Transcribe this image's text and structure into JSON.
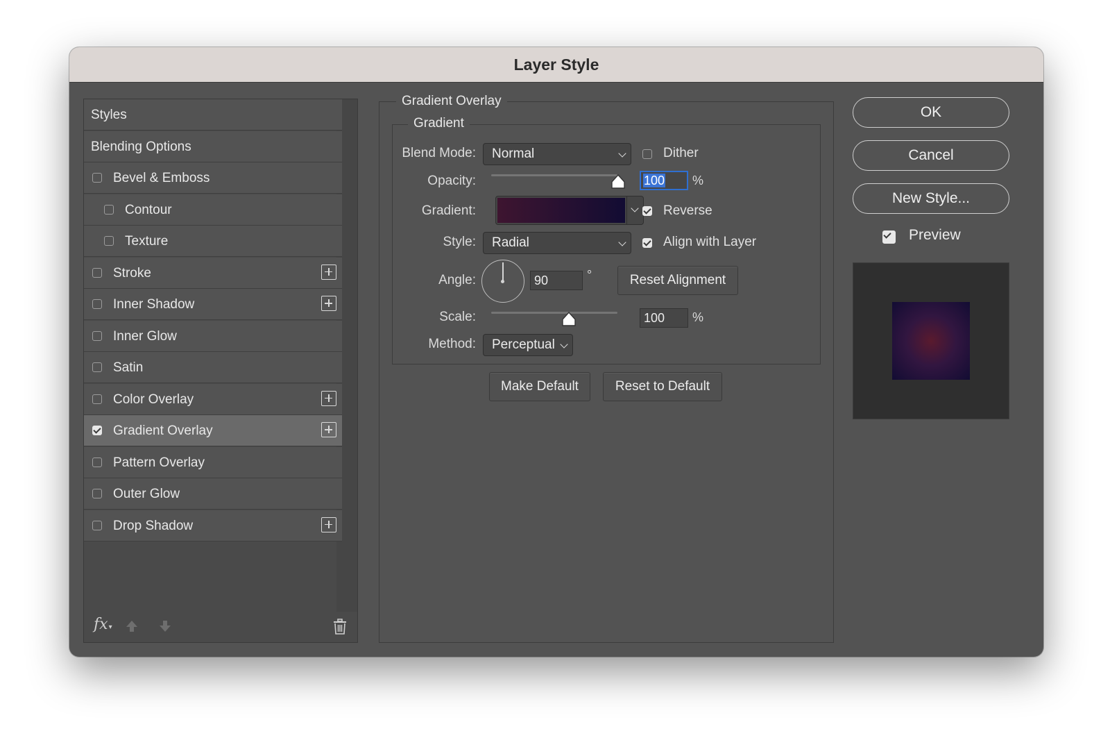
{
  "window": {
    "title": "Layer Style"
  },
  "styles_list": {
    "items": [
      {
        "label": "Styles",
        "type": "header"
      },
      {
        "label": "Blending Options",
        "type": "header"
      },
      {
        "label": "Bevel & Emboss",
        "type": "check",
        "checked": false,
        "plus": false
      },
      {
        "label": "Contour",
        "type": "sub",
        "checked": false,
        "plus": false
      },
      {
        "label": "Texture",
        "type": "sub",
        "checked": false,
        "plus": false
      },
      {
        "label": "Stroke",
        "type": "check",
        "checked": false,
        "plus": true
      },
      {
        "label": "Inner Shadow",
        "type": "check",
        "checked": false,
        "plus": true
      },
      {
        "label": "Inner Glow",
        "type": "check",
        "checked": false,
        "plus": false
      },
      {
        "label": "Satin",
        "type": "check",
        "checked": false,
        "plus": false
      },
      {
        "label": "Color Overlay",
        "type": "check",
        "checked": false,
        "plus": true
      },
      {
        "label": "Gradient Overlay",
        "type": "check",
        "checked": true,
        "plus": true,
        "selected": true
      },
      {
        "label": "Pattern Overlay",
        "type": "check",
        "checked": false,
        "plus": false
      },
      {
        "label": "Outer Glow",
        "type": "check",
        "checked": false,
        "plus": false
      },
      {
        "label": "Drop Shadow",
        "type": "check",
        "checked": false,
        "plus": true
      }
    ],
    "footer_icons": [
      "fx-icon",
      "move-up-icon",
      "move-down-icon",
      "trash-icon"
    ],
    "fx_text": "fx"
  },
  "gradient_overlay": {
    "section_title": "Gradient Overlay",
    "group_title": "Gradient",
    "blend_mode": {
      "label": "Blend Mode:",
      "value": "Normal"
    },
    "dither": {
      "label": "Dither",
      "checked": false
    },
    "opacity": {
      "label": "Opacity:",
      "value": "100",
      "unit": "%",
      "level": 100
    },
    "gradient": {
      "label": "Gradient:",
      "colors": [
        "#3e1530",
        "#120c33"
      ]
    },
    "reverse": {
      "label": "Reverse",
      "checked": true
    },
    "style": {
      "label": "Style:",
      "value": "Radial"
    },
    "align_with_layer": {
      "label": "Align with Layer",
      "checked": true
    },
    "angle": {
      "label": "Angle:",
      "value": "90",
      "unit": "°"
    },
    "reset_alignment": "Reset Alignment",
    "scale": {
      "label": "Scale:",
      "value": "100",
      "unit": "%",
      "level_fraction": 0.6
    },
    "method": {
      "label": "Method:",
      "value": "Perceptual"
    },
    "make_default": "Make Default",
    "reset_to_default": "Reset to Default"
  },
  "actions": {
    "ok": "OK",
    "cancel": "Cancel",
    "new_style": "New Style...",
    "preview": {
      "label": "Preview",
      "checked": true
    }
  }
}
